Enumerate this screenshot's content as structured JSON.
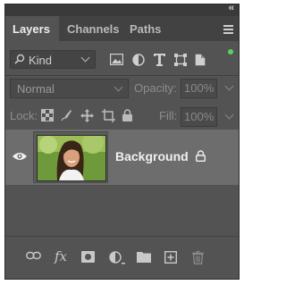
{
  "tabs": [
    {
      "label": "Layers",
      "active": true
    },
    {
      "label": "Channels",
      "active": false
    },
    {
      "label": "Paths",
      "active": false
    }
  ],
  "filter": {
    "kind_label": "Kind",
    "filter_icons": [
      "image-filter-icon",
      "adjustment-filter-icon",
      "type-filter-icon",
      "shape-filter-icon",
      "smart-object-filter-icon"
    ],
    "filter_on_color": "#57d45b"
  },
  "blend": {
    "mode": "Normal",
    "opacity_label": "Opacity:",
    "opacity_value": "100%"
  },
  "lock": {
    "label": "Lock:",
    "fill_label": "Fill:",
    "fill_value": "100%"
  },
  "layers": [
    {
      "name": "Background",
      "visible": true,
      "locked": true
    }
  ],
  "bottom_icons": [
    "link-layers-icon",
    "fx-icon",
    "add-mask-icon",
    "adjustment-layer-icon",
    "new-group-icon",
    "new-layer-icon",
    "delete-layer-icon"
  ],
  "fx_label": "fx"
}
